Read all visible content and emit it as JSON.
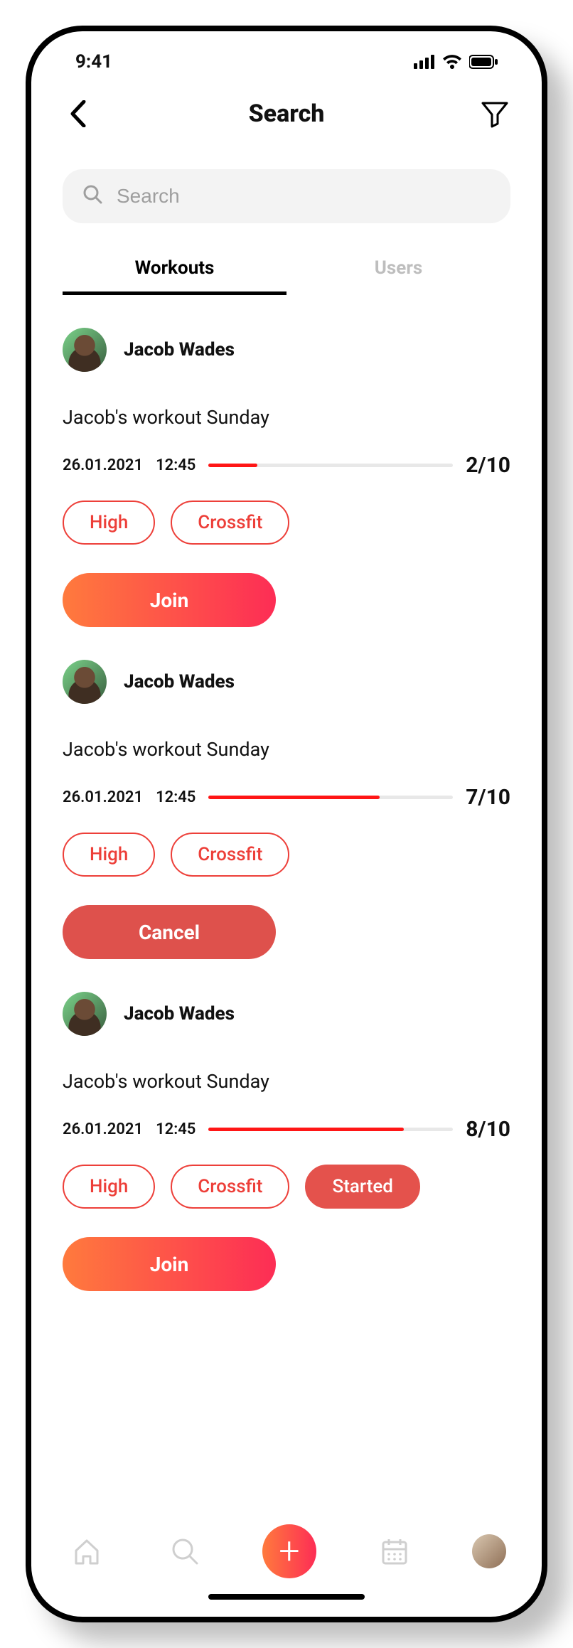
{
  "status": {
    "time": "9:41"
  },
  "header": {
    "title": "Search"
  },
  "search": {
    "placeholder": "Search"
  },
  "tabs": {
    "workouts": "Workouts",
    "users": "Users",
    "active": "workouts"
  },
  "cards": [
    {
      "user": "Jacob Wades",
      "title": "Jacob's workout Sunday",
      "date": "26.01.2021",
      "time": "12:45",
      "filled": 2,
      "total": 10,
      "count_label": "2/10",
      "tags": [
        "High",
        "Crossfit"
      ],
      "status": null,
      "action": {
        "label": "Join",
        "style": "gradient"
      }
    },
    {
      "user": "Jacob Wades",
      "title": "Jacob's workout Sunday",
      "date": "26.01.2021",
      "time": "12:45",
      "filled": 7,
      "total": 10,
      "count_label": "7/10",
      "tags": [
        "High",
        "Crossfit"
      ],
      "status": null,
      "action": {
        "label": "Cancel",
        "style": "flat"
      }
    },
    {
      "user": "Jacob Wades",
      "title": "Jacob's workout Sunday",
      "date": "26.01.2021",
      "time": "12:45",
      "filled": 8,
      "total": 10,
      "count_label": "8/10",
      "tags": [
        "High",
        "Crossfit"
      ],
      "status": "Started",
      "action": {
        "label": "Join",
        "style": "gradient"
      }
    }
  ]
}
